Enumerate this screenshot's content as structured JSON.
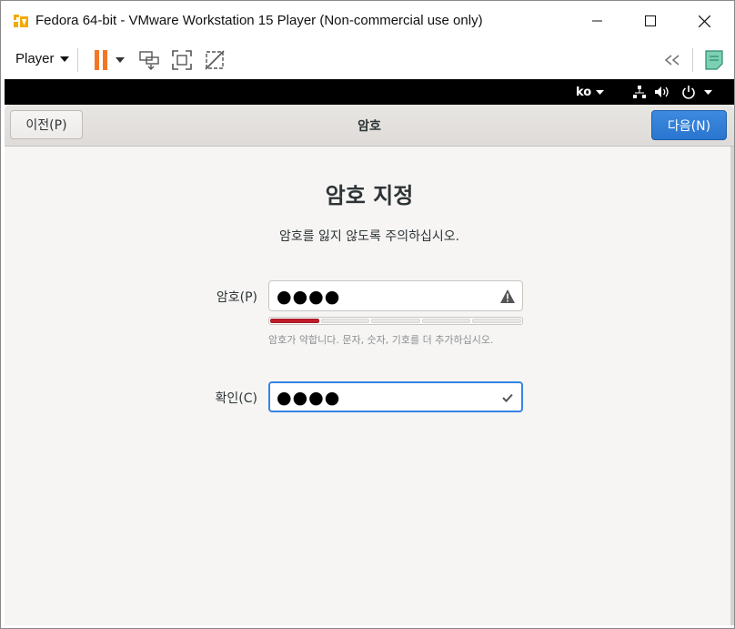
{
  "window": {
    "title": "Fedora 64-bit - VMware Workstation 15 Player (Non-commercial use only)"
  },
  "toolbar": {
    "player_label": "Player"
  },
  "topbar": {
    "language": "ko"
  },
  "header": {
    "prev_label": "이전(P)",
    "title": "암호",
    "next_label": "다음(N)"
  },
  "page": {
    "heading": "암호 지정",
    "subtitle": "암호를 잃지 않도록 주의하십시오."
  },
  "form": {
    "password": {
      "label": "암호(P)",
      "value": "●●●●",
      "strength": 0.2,
      "hint": "암호가 약합니다. 문자, 숫자, 기호를 더 추가하십시오."
    },
    "confirm": {
      "label": "확인(C)",
      "value": "●●●●"
    }
  },
  "colors": {
    "accent": "#3584e4",
    "weak": "#c01c28",
    "pause": "#f37626"
  }
}
